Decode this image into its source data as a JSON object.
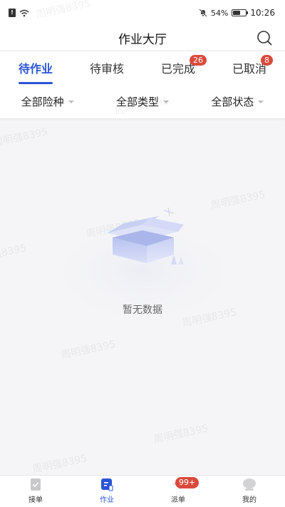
{
  "status_bar": {
    "battery": "54%",
    "time": "10:26"
  },
  "header": {
    "title": "作业大厅"
  },
  "tabs": [
    {
      "label": "待作业",
      "active": true,
      "badge": ""
    },
    {
      "label": "待审核",
      "active": false,
      "badge": ""
    },
    {
      "label": "已完成",
      "active": false,
      "badge": "26"
    },
    {
      "label": "已取消",
      "active": false,
      "badge": "8"
    }
  ],
  "filters": [
    {
      "label": "全部险种"
    },
    {
      "label": "全部类型"
    },
    {
      "label": "全部状态"
    }
  ],
  "empty_state": {
    "text": "暂无数据"
  },
  "watermark": "周明强8395",
  "bottom_nav": [
    {
      "label": "接单",
      "icon": "clipboard-check-icon",
      "active": false,
      "badge": ""
    },
    {
      "label": "作业",
      "icon": "edit-note-icon",
      "active": true,
      "badge": ""
    },
    {
      "label": "派单",
      "icon": "send-icon",
      "active": false,
      "badge": "99+"
    },
    {
      "label": "我的",
      "icon": "user-icon",
      "active": false,
      "badge": ""
    }
  ],
  "colors": {
    "accent": "#2b54d6",
    "badge": "#d94a3d"
  }
}
